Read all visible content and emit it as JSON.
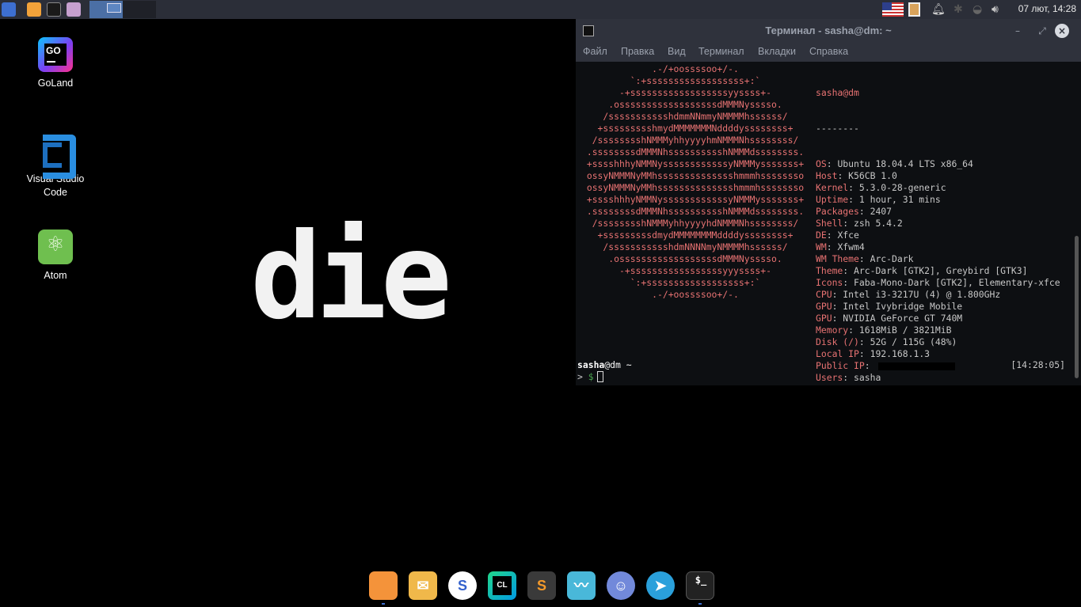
{
  "top_panel": {
    "clock": "07 лют, 14:28",
    "icons": [
      "whisker-menu-icon",
      "firefox-icon",
      "terminal-icon",
      "files-icon",
      "us-flag-icon",
      "clipboard-icon",
      "bell-icon",
      "bluetooth-icon",
      "wifi-icon",
      "volume-icon"
    ]
  },
  "desktop": {
    "icons": [
      {
        "label": "GoLand",
        "glyph": "GO"
      },
      {
        "label": "Visual Studio Code"
      },
      {
        "label": "Atom",
        "glyph": "⚛"
      }
    ],
    "wallpaper_text": "die"
  },
  "terminal": {
    "title": "Терминал - sasha@dm: ~",
    "menu": [
      "Файл",
      "Правка",
      "Вид",
      "Терминал",
      "Вкладки",
      "Справка"
    ],
    "logo": [
      ".-/+oossssoo+/-.",
      "`:+ssssssssssssssssss+:`",
      "-+ssssssssssssssssssyyssss+-",
      ".ossssssssssssssssssdMMMNysssso.",
      "/ssssssssssshdmmNNmmyNMMMMhssssss/",
      "+ssssssssshmydMMMMMMMNddddyssssssss+",
      "/sssssssshNMMMyhhyyyyhmNMMMNhssssssss/",
      ".ssssssssdMMMNhsssssssssshNMMMdssssssss.",
      "+sssshhhyNMMNyssssssssssssyNMMMysssssss+",
      "ossyNMMMNyMMhsssssssssssssshmmmhssssssso",
      "ossyNMMMNyMMhsssssssssssssshmmmhssssssso",
      "+sssshhhyNMMNyssssssssssssyNMMMysssssss+",
      ".ssssssssdMMMNhsssssssssshNMMMdssssssss.",
      "/sssssssshNMMMyhhyyyyhdNMMMNhssssssss/",
      "+sssssssssdmydMMMMMMMMddddyssssssss+",
      "/ssssssssssshdmNNNNmyNMMMMhssssss/",
      ".ossssssssssssssssssdMMMNysssso.",
      "-+sssssssssssssssssyyyssss+-",
      "`:+ssssssssssssssssss+:`",
      ".-/+oossssoo+/-."
    ],
    "info_user": "sasha@dm",
    "info_separator": "--------",
    "info": [
      {
        "key": "OS",
        "value": "Ubuntu 18.04.4 LTS x86_64"
      },
      {
        "key": "Host",
        "value": "K56CB 1.0"
      },
      {
        "key": "Kernel",
        "value": "5.3.0-28-generic"
      },
      {
        "key": "Uptime",
        "value": "1 hour, 31 mins"
      },
      {
        "key": "Packages",
        "value": "2407"
      },
      {
        "key": "Shell",
        "value": "zsh 5.4.2"
      },
      {
        "key": "DE",
        "value": "Xfce"
      },
      {
        "key": "WM",
        "value": "Xfwm4"
      },
      {
        "key": "WM Theme",
        "value": "Arc-Dark"
      },
      {
        "key": "Theme",
        "value": "Arc-Dark [GTK2], Greybird [GTK3]"
      },
      {
        "key": "Icons",
        "value": "Faba-Mono-Dark [GTK2], Elementary-xfce"
      },
      {
        "key": "CPU",
        "value": "Intel i3-3217U (4) @ 1.800GHz"
      },
      {
        "key": "GPU",
        "value": "Intel Ivybridge Mobile"
      },
      {
        "key": "GPU",
        "value": "NVIDIA GeForce GT 740M"
      },
      {
        "key": "Memory",
        "value": "1618MiB / 3821MiB"
      },
      {
        "key": "Disk (/)",
        "value": "52G / 115G (48%)"
      },
      {
        "key": "Local IP",
        "value": "192.168.1.3"
      },
      {
        "key": "Public IP",
        "value": ""
      },
      {
        "key": "Users",
        "value": "sasha"
      }
    ],
    "prompt_user": "sasha",
    "prompt_host": "@dm ~",
    "prompt_time": "[14:28:05]",
    "prompt_arrow": ">",
    "prompt_symbol": "$"
  },
  "dock": {
    "items": [
      {
        "name": "firefox",
        "glyph": ""
      },
      {
        "name": "mail",
        "glyph": "✉"
      },
      {
        "name": "simplenote",
        "glyph": "S"
      },
      {
        "name": "clion",
        "glyph": "CL"
      },
      {
        "name": "sublime-text",
        "glyph": "S"
      },
      {
        "name": "system-monitor",
        "glyph": "〰"
      },
      {
        "name": "discord",
        "glyph": "☺"
      },
      {
        "name": "telegram",
        "glyph": "➤"
      },
      {
        "name": "terminal",
        "glyph": "$_"
      }
    ]
  }
}
